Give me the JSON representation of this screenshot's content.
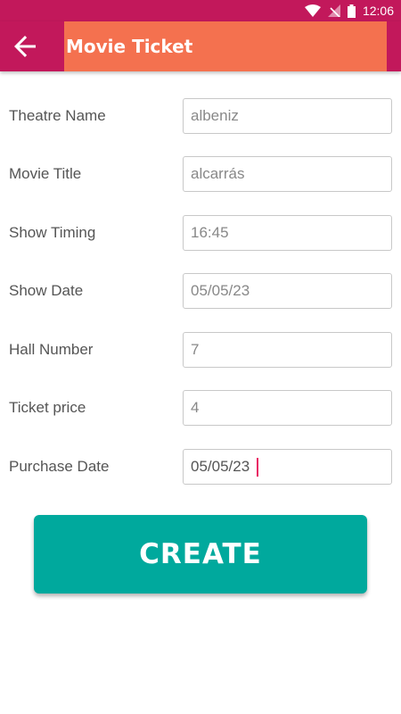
{
  "status_bar": {
    "time": "12:06"
  },
  "app_bar": {
    "title": "Movie Ticket"
  },
  "form": {
    "fields": [
      {
        "label": "Theatre Name",
        "value": "albeniz"
      },
      {
        "label": "Movie Title",
        "value": "alcarrás"
      },
      {
        "label": "Show Timing",
        "value": "16:45"
      },
      {
        "label": "Show Date",
        "value": "05/05/23"
      },
      {
        "label": "Hall Number",
        "value": "7"
      },
      {
        "label": "Ticket price",
        "value": "4"
      },
      {
        "label": "Purchase Date",
        "value": "05/05/23"
      }
    ]
  },
  "create_button": {
    "label": "CREATE"
  },
  "colors": {
    "primary": "#c2185b",
    "title_background": "#f4714f",
    "button": "#00a99d",
    "caret": "#e91e63"
  },
  "icons": [
    "wifi-icon",
    "no-signal-icon",
    "battery-icon",
    "back-arrow-icon"
  ]
}
